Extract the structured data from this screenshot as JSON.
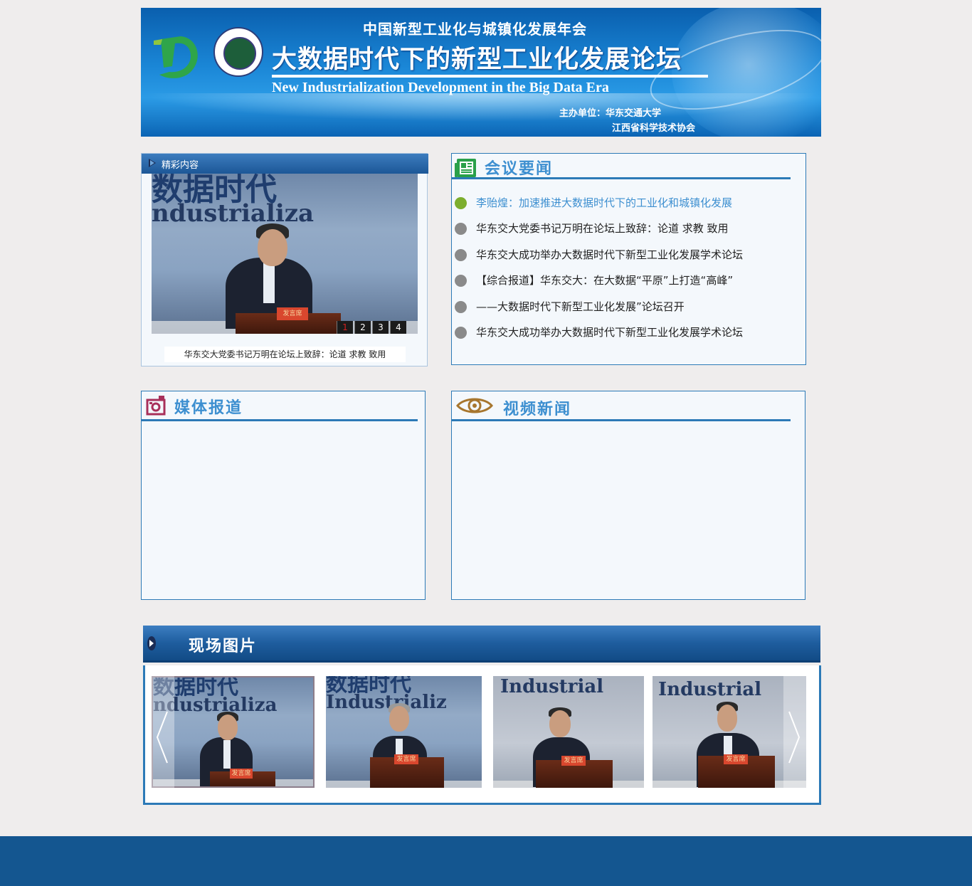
{
  "banner": {
    "subtitle": "中国新型工业化与城镇化发展年会",
    "title": "大数据时代下的新型工业化发展论坛",
    "english": "New Industrialization Development in the Big Data Era",
    "host_line1": "主办单位：华东交通大学",
    "host_line2": "江西省科学技术协会",
    "logo_d": "D"
  },
  "featured": {
    "header": "精彩内容",
    "photo_text": "ndustrializa",
    "photo_text_top": "数据时代",
    "plate": "发言席",
    "pager": [
      "1",
      "2",
      "3",
      "4"
    ],
    "active_page": "1",
    "caption": "华东交大党委书记万明在论坛上致辞：论道  求教  致用"
  },
  "news": {
    "title": "会议要闻",
    "items": [
      "李贻煌：加速推进大数据时代下的工业化和城镇化发展",
      "华东交大党委书记万明在论坛上致辞：论道   求教   致用",
      "华东交大成功举办大数据时代下新型工业化发展学术论坛",
      "【综合报道】华东交大：在大数据“平原”上打造“高峰”",
      "——大数据时代下新型工业化发展”论坛召开",
      "华东交大成功举办大数据时代下新型工业化发展学术论坛"
    ]
  },
  "media": {
    "title": "媒体报道"
  },
  "video": {
    "title": "视频新闻"
  },
  "photos": {
    "title": "现场图片",
    "items": [
      {
        "text": "ndustrializa"
      },
      {
        "text": "Industrializ"
      },
      {
        "text": "Industrial"
      },
      {
        "text": "Industrial"
      }
    ]
  },
  "colors": {
    "accent": "#3d8fd0",
    "border": "#2c7ab7",
    "footer": "#145690",
    "active_dot": "#7cae2e"
  },
  "icons": {
    "featured_header": "play-triangle-icon",
    "news": "newspaper-icon",
    "media": "camera-icon",
    "video": "eye-icon",
    "photos_header": "arrow-right-icon",
    "prev": "chevron-left-icon",
    "next": "chevron-right-icon"
  }
}
